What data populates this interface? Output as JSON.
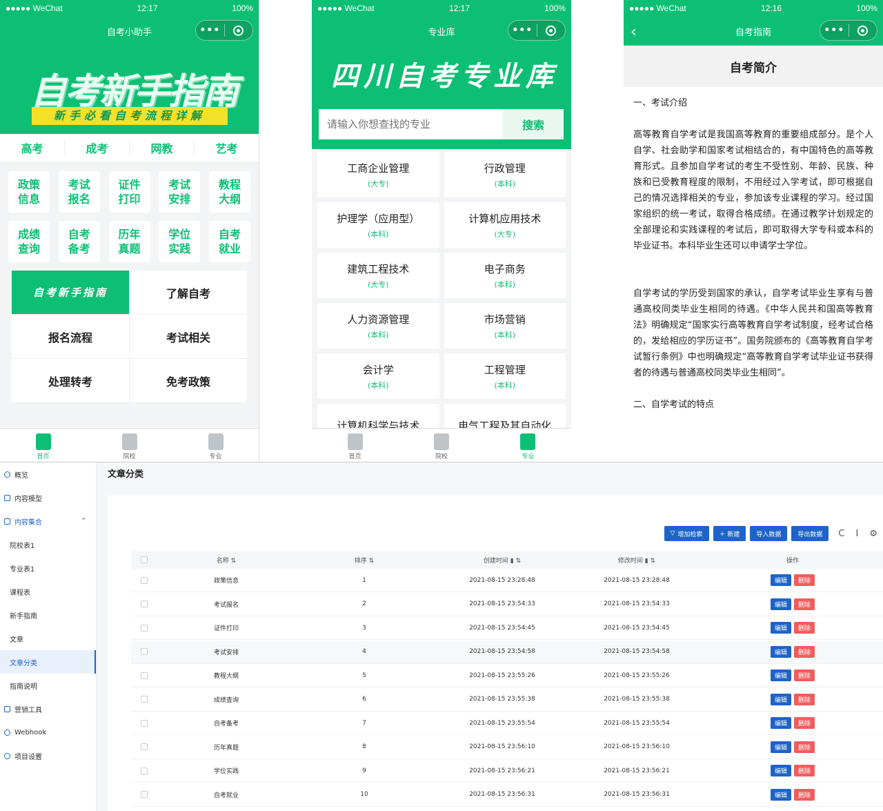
{
  "status_bar": {
    "carrier": "●●●●● WeChat",
    "battery": "100%",
    "time1": "12:17",
    "time2": "12:17",
    "time3": "12:16"
  },
  "capsule": {
    "dots": "•••"
  },
  "phone1": {
    "nav_title": "自考小助手",
    "banner_title": "自考新手指南",
    "banner_subtitle": "新手必看自考流程详解",
    "cat_tabs": [
      "高考",
      "成考",
      "网教",
      "艺考"
    ],
    "icon_grid": [
      [
        "政策信息",
        "考试报名",
        "证件打印",
        "考试安排",
        "教程大纲"
      ],
      [
        "成绩查询",
        "自考备考",
        "历年真题",
        "学位实践",
        "自考就业"
      ]
    ],
    "menu": [
      "自考新手指南",
      "了解自考",
      "报名流程",
      "考试相关",
      "处理转考",
      "免考政策"
    ],
    "tabbar": [
      "首页",
      "院校",
      "专业"
    ]
  },
  "phone2": {
    "nav_title": "专业库",
    "header_title": "四川自考专业库",
    "search_placeholder": "请输入你想查找的专业",
    "search_button": "搜索",
    "majors": [
      {
        "name": "工商企业管理",
        "level": "(大专)"
      },
      {
        "name": "行政管理",
        "level": "(本科)"
      },
      {
        "name": "护理学（应用型）",
        "level": "(本科)"
      },
      {
        "name": "计算机应用技术",
        "level": "(大专)"
      },
      {
        "name": "建筑工程技术",
        "level": "(大专)"
      },
      {
        "name": "电子商务",
        "level": "(本科)"
      },
      {
        "name": "人力资源管理",
        "level": "(本科)"
      },
      {
        "name": "市场营销",
        "level": "(本科)"
      },
      {
        "name": "会计学",
        "level": "(本科)"
      },
      {
        "name": "工程管理",
        "level": "(本科)"
      },
      {
        "name": "计算机科学与技术",
        "level": ""
      },
      {
        "name": "电气工程及其自动化",
        "level": ""
      }
    ],
    "tabbar": [
      "首页",
      "院校",
      "专业"
    ]
  },
  "phone3": {
    "nav_title": "自考指南",
    "title": "自考简介",
    "paragraphs": [
      "一、考试介绍",
      "高等教育自学考试是我国高等教育的重要组成部分。是个人自学、社会助学和国家考试相结合的，有中国特色的高等教育形式。且参加自学考试的考生不受性别、年龄、民族、种族和已受教育程度的限制，不用经过入学考试，即可根据自己的情况选择相关的专业，参加该专业课程的学习。经过国家组织的统一考试，取得合格成绩。在通过教学计划规定的全部理论和实践课程的考试后，即可取得大学专科或本科的毕业证书。本科毕业生还可以申请学士学位。",
      "自学考试的学历受到国家的承认，自学考试毕业生享有与普通高校同类毕业生相同的待遇。《中华人民共和国高等教育法》明确规定“国家实行高等教育自学考试制度，经考试合格的，发给相应的学历证书”。国务院颁布的《高等教育自学考试暂行条例》中也明确规定“高等教育自学考试毕业证书获得者的待遇与普通高校同类毕业生相同”。",
      "二、自学考试的特点"
    ]
  },
  "admin": {
    "page_title": "文章分类",
    "sidebar": {
      "top": [
        "概览",
        "内容模型"
      ],
      "group": "内容集合",
      "sub": [
        "院校表1",
        "专业表1",
        "课程表",
        "新手指南",
        "文章",
        "文章分类",
        "指南说明"
      ],
      "bottom": [
        "营销工具",
        "Webhook",
        "项目设置"
      ]
    },
    "toolbar": {
      "add_filter": "增加检索",
      "new": "＋ 新建",
      "import": "导入数据",
      "export": "导出数据",
      "refresh_icon": "C",
      "column_icon": "I",
      "settings_icon": "⚙"
    },
    "columns": [
      "名称",
      "排序",
      "创建时间",
      "修改时间",
      "操作"
    ],
    "sort_mark": "⇅",
    "edit_label": "编辑",
    "delete_label": "删除",
    "rows": [
      {
        "name": "政策信息",
        "order": "1",
        "created": "2021-08-15 23:28:48",
        "modified": "2021-08-15 23:28:48"
      },
      {
        "name": "考试报名",
        "order": "2",
        "created": "2021-08-15 23:54:33",
        "modified": "2021-08-15 23:54:33"
      },
      {
        "name": "证件打印",
        "order": "3",
        "created": "2021-08-15 23:54:45",
        "modified": "2021-08-15 23:54:45"
      },
      {
        "name": "考试安排",
        "order": "4",
        "created": "2021-08-15 23:54:58",
        "modified": "2021-08-15 23:54:58"
      },
      {
        "name": "教程大纲",
        "order": "5",
        "created": "2021-08-15 23:55:26",
        "modified": "2021-08-15 23:55:26"
      },
      {
        "name": "成绩查询",
        "order": "6",
        "created": "2021-08-15 23:55:38",
        "modified": "2021-08-15 23:55:38"
      },
      {
        "name": "自考备考",
        "order": "7",
        "created": "2021-08-15 23:55:54",
        "modified": "2021-08-15 23:55:54"
      },
      {
        "name": "历年真题",
        "order": "8",
        "created": "2021-08-15 23:56:10",
        "modified": "2021-08-15 23:56:10"
      },
      {
        "name": "学位实践",
        "order": "9",
        "created": "2021-08-15 23:56:21",
        "modified": "2021-08-15 23:56:21"
      },
      {
        "name": "自考就业",
        "order": "10",
        "created": "2021-08-15 23:56:31",
        "modified": "2021-08-15 23:56:31"
      }
    ]
  },
  "colors": {
    "brand_green": "#0dbf74",
    "admin_blue": "#1e63c9",
    "danger_red": "#f25c5c"
  }
}
